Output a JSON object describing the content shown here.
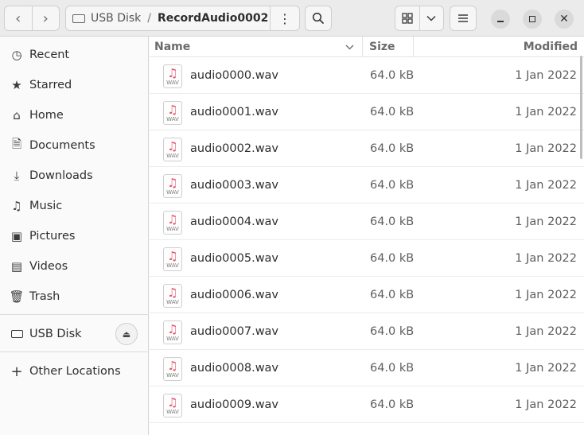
{
  "path": {
    "root": "USB Disk",
    "separator": "/",
    "current": "RecordAudio0002"
  },
  "sidebar": {
    "places": [
      {
        "label": "Recent",
        "icon": "clock-icon",
        "glyph": "◷"
      },
      {
        "label": "Starred",
        "icon": "star-icon",
        "glyph": "★"
      },
      {
        "label": "Home",
        "icon": "home-icon",
        "glyph": "⌂"
      },
      {
        "label": "Documents",
        "icon": "document-icon",
        "glyph": "🗎"
      },
      {
        "label": "Downloads",
        "icon": "download-icon",
        "glyph": "⤓"
      },
      {
        "label": "Music",
        "icon": "music-icon",
        "glyph": "♫"
      },
      {
        "label": "Pictures",
        "icon": "picture-icon",
        "glyph": "▣"
      },
      {
        "label": "Videos",
        "icon": "video-icon",
        "glyph": "▤"
      },
      {
        "label": "Trash",
        "icon": "trash-icon",
        "glyph": "🗑"
      }
    ],
    "device": {
      "label": "USB Disk",
      "icon": "drive-icon",
      "glyph": "▭"
    },
    "other": {
      "label": "Other Locations",
      "icon": "plus-icon",
      "glyph": "+"
    }
  },
  "columns": {
    "name": "Name",
    "size": "Size",
    "modified": "Modified"
  },
  "files": [
    {
      "name": "audio0000.wav",
      "size": "64.0 kB",
      "modified": "1 Jan 2022",
      "ext": "WAV"
    },
    {
      "name": "audio0001.wav",
      "size": "64.0 kB",
      "modified": "1 Jan 2022",
      "ext": "WAV"
    },
    {
      "name": "audio0002.wav",
      "size": "64.0 kB",
      "modified": "1 Jan 2022",
      "ext": "WAV"
    },
    {
      "name": "audio0003.wav",
      "size": "64.0 kB",
      "modified": "1 Jan 2022",
      "ext": "WAV"
    },
    {
      "name": "audio0004.wav",
      "size": "64.0 kB",
      "modified": "1 Jan 2022",
      "ext": "WAV"
    },
    {
      "name": "audio0005.wav",
      "size": "64.0 kB",
      "modified": "1 Jan 2022",
      "ext": "WAV"
    },
    {
      "name": "audio0006.wav",
      "size": "64.0 kB",
      "modified": "1 Jan 2022",
      "ext": "WAV"
    },
    {
      "name": "audio0007.wav",
      "size": "64.0 kB",
      "modified": "1 Jan 2022",
      "ext": "WAV"
    },
    {
      "name": "audio0008.wav",
      "size": "64.0 kB",
      "modified": "1 Jan 2022",
      "ext": "WAV"
    },
    {
      "name": "audio0009.wav",
      "size": "64.0 kB",
      "modified": "1 Jan 2022",
      "ext": "WAV"
    }
  ],
  "colors": {
    "accent_music": "#e0566d",
    "headerbar": "#ebebeb",
    "sidebar": "#fafafa"
  }
}
